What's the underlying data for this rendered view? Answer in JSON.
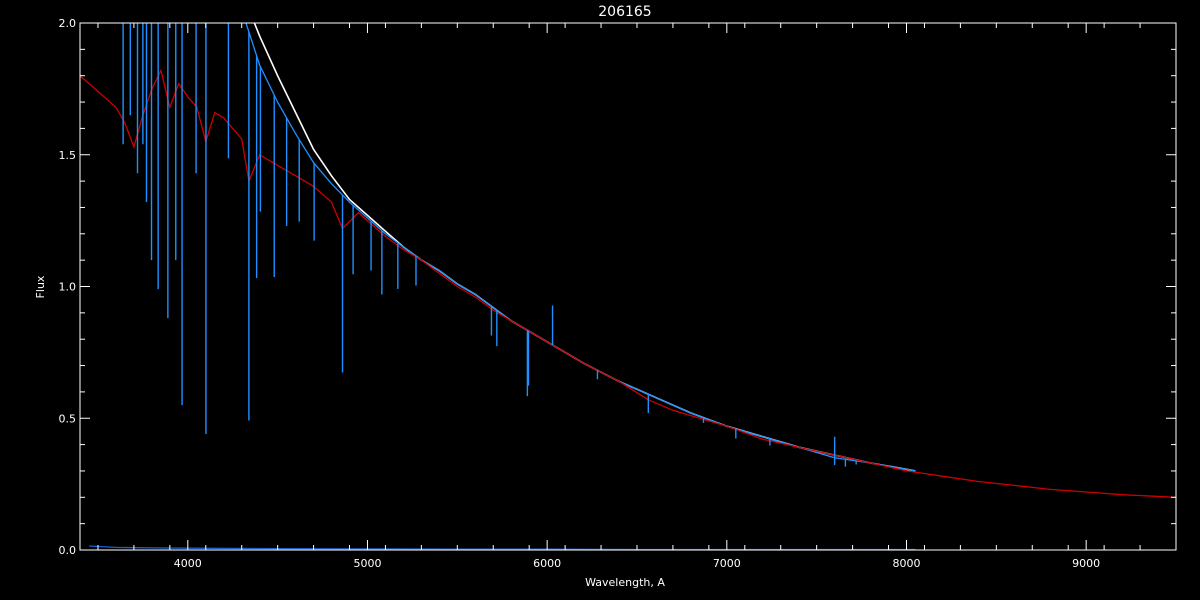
{
  "chart_data": {
    "type": "line",
    "title": "206165",
    "xlabel": "Wavelength, A",
    "ylabel": "Flux",
    "xlim": [
      3400,
      9500
    ],
    "ylim": [
      0.0,
      2.0
    ],
    "x_ticks": [
      4000,
      5000,
      6000,
      7000,
      8000,
      9000
    ],
    "x_tick_labels": [
      "4000",
      "5000",
      "6000",
      "7000",
      "8000",
      "9000"
    ],
    "y_ticks": [
      0.0,
      0.5,
      1.0,
      1.5,
      2.0
    ],
    "y_tick_labels": [
      "0.0",
      "0.5",
      "1.0",
      "1.5",
      "2.0"
    ],
    "grid": false,
    "colors": {
      "background": "#000000",
      "axes": "#ffffff",
      "observed_white": "#ffffff",
      "observed_blue": "#1e90ff",
      "model_red": "#cc0000",
      "error_blue": "#1e5fd0"
    },
    "series": [
      {
        "key": "white",
        "color": "#ffffff",
        "x": [
          3400,
          3550,
          3700,
          3850,
          4000,
          4150,
          4300,
          4400,
          4500,
          4600,
          4700,
          4800,
          4900,
          5000,
          5100,
          5200,
          5300,
          5400,
          5500,
          5600,
          5700,
          5800,
          5900,
          6000,
          6200,
          6400,
          6600,
          6800,
          7000,
          7200,
          7400,
          7600,
          7800,
          8050
        ],
        "y": [
          2.2,
          2.2,
          2.2,
          2.2,
          2.2,
          2.2,
          2.12,
          1.95,
          1.8,
          1.66,
          1.52,
          1.42,
          1.33,
          1.27,
          1.21,
          1.15,
          1.1,
          1.06,
          1.01,
          0.97,
          0.92,
          0.87,
          0.83,
          0.79,
          0.71,
          0.64,
          0.58,
          0.52,
          0.47,
          0.43,
          0.39,
          0.36,
          0.33,
          0.3
        ]
      },
      {
        "key": "blue",
        "color": "#1e90ff",
        "x": [
          3400,
          3550,
          3700,
          3850,
          4000,
          4150,
          4300,
          4400,
          4500,
          4600,
          4700,
          4800,
          4900,
          5000,
          5100,
          5200,
          5300,
          5400,
          5500,
          5600,
          5700,
          5800,
          5900,
          6000,
          6200,
          6400,
          6600,
          6800,
          7000,
          7200,
          7400,
          7600,
          7800,
          8050
        ],
        "y": [
          2.2,
          2.2,
          2.2,
          2.2,
          2.2,
          2.2,
          2.05,
          1.84,
          1.7,
          1.58,
          1.47,
          1.39,
          1.32,
          1.26,
          1.2,
          1.15,
          1.1,
          1.06,
          1.01,
          0.97,
          0.92,
          0.87,
          0.83,
          0.79,
          0.71,
          0.64,
          0.58,
          0.52,
          0.47,
          0.43,
          0.39,
          0.35,
          0.33,
          0.3
        ]
      },
      {
        "key": "red",
        "color": "#cc0000",
        "x": [
          3400,
          3500,
          3600,
          3650,
          3700,
          3750,
          3800,
          3850,
          3900,
          3950,
          4000,
          4050,
          4100,
          4150,
          4200,
          4250,
          4300,
          4340,
          4400,
          4500,
          4600,
          4700,
          4800,
          4861,
          4950,
          5000,
          5100,
          5200,
          5300,
          5400,
          5500,
          5600,
          5700,
          5800,
          5900,
          6000,
          6200,
          6400,
          6563,
          6700,
          6800,
          7000,
          7200,
          7400,
          7600,
          7800,
          8000,
          8200,
          8400,
          8600,
          8800,
          9000,
          9200,
          9500
        ],
        "y": [
          1.8,
          1.74,
          1.68,
          1.62,
          1.53,
          1.65,
          1.75,
          1.82,
          1.68,
          1.77,
          1.72,
          1.68,
          1.55,
          1.66,
          1.64,
          1.6,
          1.56,
          1.4,
          1.5,
          1.46,
          1.42,
          1.38,
          1.32,
          1.22,
          1.28,
          1.25,
          1.19,
          1.14,
          1.1,
          1.05,
          1.0,
          0.96,
          0.91,
          0.87,
          0.83,
          0.79,
          0.71,
          0.64,
          0.57,
          0.53,
          0.51,
          0.47,
          0.42,
          0.39,
          0.36,
          0.33,
          0.3,
          0.28,
          0.26,
          0.245,
          0.23,
          0.22,
          0.21,
          0.2
        ]
      },
      {
        "key": "error",
        "color": "#1e5fd0",
        "x": [
          3450,
          3600,
          3800,
          4000,
          4500,
          5000,
          5500,
          6000,
          6500,
          7000,
          7500,
          8050
        ],
        "y": [
          0.015,
          0.01,
          0.008,
          0.007,
          0.005,
          0.004,
          0.003,
          0.003,
          0.002,
          0.002,
          0.002,
          0.002
        ]
      }
    ],
    "absorption_lines": [
      {
        "x": 3640,
        "depth": 0.3
      },
      {
        "x": 3680,
        "depth": 0.25
      },
      {
        "x": 3720,
        "depth": 0.35
      },
      {
        "x": 3750,
        "depth": 0.3
      },
      {
        "x": 3770,
        "depth": 0.4
      },
      {
        "x": 3798,
        "depth": 0.5
      },
      {
        "x": 3835,
        "depth": 0.55
      },
      {
        "x": 3889,
        "depth": 0.6
      },
      {
        "x": 3933,
        "depth": 0.5
      },
      {
        "x": 3968,
        "depth": 0.75
      },
      {
        "x": 4046,
        "depth": 0.35
      },
      {
        "x": 4101,
        "depth": 0.8
      },
      {
        "x": 4226,
        "depth": 0.3
      },
      {
        "x": 4340,
        "depth": 0.75
      },
      {
        "x": 4383,
        "depth": 0.45
      },
      {
        "x": 4404,
        "depth": 0.3
      },
      {
        "x": 4481,
        "depth": 0.4
      },
      {
        "x": 4550,
        "depth": 0.25
      },
      {
        "x": 4620,
        "depth": 0.2
      },
      {
        "x": 4703,
        "depth": 0.2
      },
      {
        "x": 4861,
        "depth": 0.5
      },
      {
        "x": 4920,
        "depth": 0.2
      },
      {
        "x": 5020,
        "depth": 0.15
      },
      {
        "x": 5080,
        "depth": 0.2
      },
      {
        "x": 5169,
        "depth": 0.15
      },
      {
        "x": 5270,
        "depth": 0.1
      },
      {
        "x": 5690,
        "depth": 0.12
      },
      {
        "x": 5720,
        "depth": 0.15
      },
      {
        "x": 5890,
        "depth": 0.3
      },
      {
        "x": 5896,
        "depth": 0.25
      },
      {
        "x": 6280,
        "depth": 0.05
      },
      {
        "x": 6563,
        "depth": 0.12
      },
      {
        "x": 6870,
        "depth": 0.04
      },
      {
        "x": 7050,
        "depth": 0.08
      },
      {
        "x": 7240,
        "depth": 0.06
      },
      {
        "x": 7600,
        "depth": 0.08
      },
      {
        "x": 7660,
        "depth": 0.08
      },
      {
        "x": 7720,
        "depth": 0.04
      }
    ],
    "emission_spikes": [
      {
        "x": 6030,
        "height": 0.15
      },
      {
        "x": 7600,
        "height": 0.08
      }
    ]
  }
}
